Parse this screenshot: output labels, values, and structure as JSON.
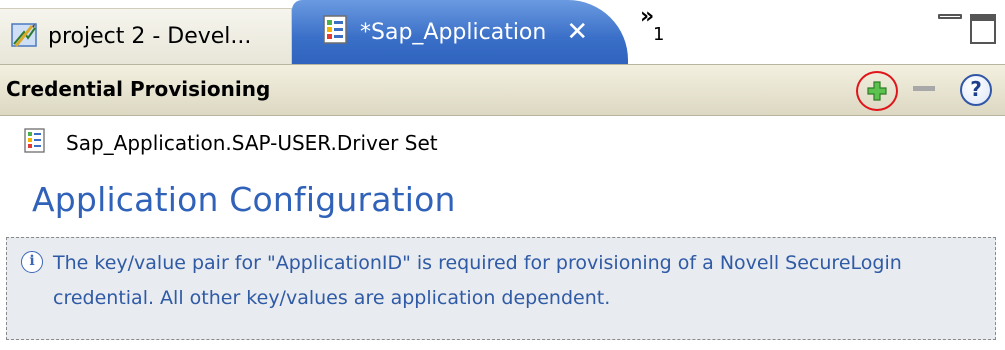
{
  "tabs": [
    {
      "label": "project 2 - Devel...",
      "active": false,
      "icon": "project-designer-icon"
    },
    {
      "label": "*Sap_Application",
      "active": true,
      "icon": "form-document-icon",
      "close_glyph": "✕"
    }
  ],
  "tab_overflow": {
    "chevron": "»",
    "count": "1"
  },
  "section": {
    "title": "Credential Provisioning",
    "actions": [
      {
        "name": "add",
        "icon": "plus-icon",
        "highlighted": true
      },
      {
        "name": "remove",
        "icon": "minus-icon",
        "enabled": false
      },
      {
        "name": "help",
        "icon": "help-icon",
        "glyph": "?"
      }
    ]
  },
  "driver_set": {
    "label": "Sap_Application.SAP-USER.Driver Set",
    "icon": "form-document-icon"
  },
  "page_title": "Application Configuration",
  "info": {
    "icon": "info-icon",
    "glyph": "i",
    "text": "The key/value pair for \"ApplicationID\" is required for provisioning of a Novell SecureLogin credential. All other key/values are application dependent."
  },
  "colors": {
    "active_tab": "#3a6fc8",
    "title_blue": "#2f62b8",
    "highlight_red": "#e0151b",
    "plus_green": "#3aa832",
    "info_bg": "#e8ebef"
  }
}
